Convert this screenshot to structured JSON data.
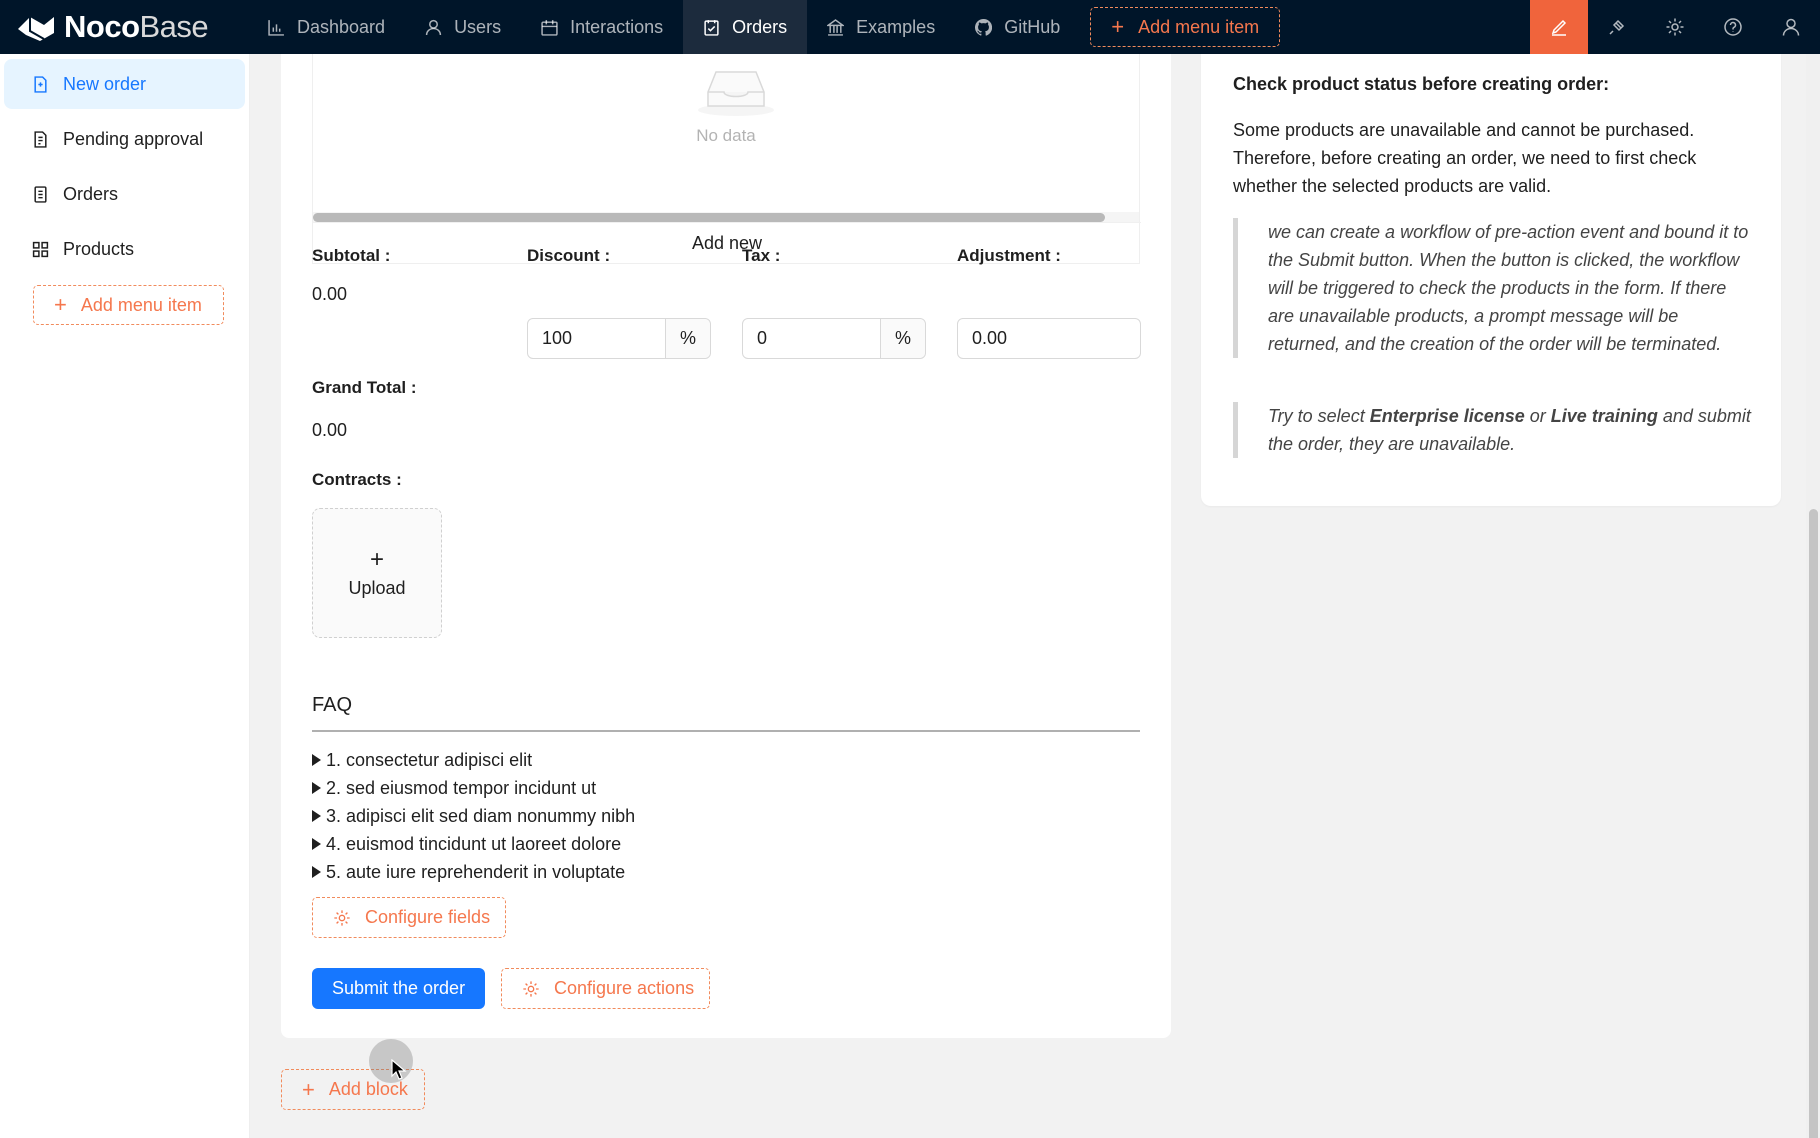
{
  "brand": {
    "name_bold": "Noco",
    "name_thin": "Base"
  },
  "topnav": {
    "items": [
      {
        "label": "Dashboard",
        "icon": "bar-chart-icon"
      },
      {
        "label": "Users",
        "icon": "user-icon"
      },
      {
        "label": "Interactions",
        "icon": "calendar-icon"
      },
      {
        "label": "Orders",
        "icon": "schedule-icon",
        "active": true
      },
      {
        "label": "Examples",
        "icon": "bank-icon"
      },
      {
        "label": "GitHub",
        "icon": "github-icon"
      }
    ],
    "add_menu_item": "Add menu item"
  },
  "sidebar": {
    "items": [
      {
        "label": "New order",
        "active": true
      },
      {
        "label": "Pending approval"
      },
      {
        "label": "Orders"
      },
      {
        "label": "Products"
      }
    ],
    "add_menu_item": "Add menu item"
  },
  "table": {
    "empty_text": "No data",
    "add_new": "Add new"
  },
  "form": {
    "subtotal": {
      "label": "Subtotal",
      "value": "0.00"
    },
    "discount": {
      "label": "Discount",
      "value": "100",
      "unit": "%"
    },
    "tax": {
      "label": "Tax",
      "value": "0",
      "unit": "%"
    },
    "adjustment": {
      "label": "Adjustment",
      "value": "0.00"
    },
    "grand_total": {
      "label": "Grand Total",
      "value": "0.00"
    },
    "contracts": {
      "label": "Contracts",
      "upload": "Upload"
    }
  },
  "faq": {
    "title": "FAQ",
    "items": [
      "1. consectetur adipisci elit",
      "2. sed eiusmod tempor incidunt ut",
      "3. adipisci elit sed diam nonummy nibh",
      "4. euismod tincidunt ut laoreet dolore",
      "5. aute iure reprehenderit in voluptate"
    ]
  },
  "actions": {
    "configure_fields": "Configure fields",
    "submit": "Submit the order",
    "configure_actions": "Configure actions",
    "add_block": "Add block"
  },
  "info": {
    "title": "Check product status before creating order:",
    "paragraph": "Some products are unavailable and cannot be purchased. Therefore, before creating an order, we need to first check whether the selected products are valid.",
    "quote1": "we can create a workflow of pre-action event and bound it to the Submit button. When the button is clicked, the workflow will be triggered to check the products in the form. If there are unavailable products, a prompt message will be returned, and the creation of the order will be terminated.",
    "quote2_pre": "Try to select ",
    "quote2_b1": "Enterprise license",
    "quote2_mid": " or ",
    "quote2_b2": "Live training",
    "quote2_post": " and submit the order, they are unavailable."
  },
  "colors": {
    "topbar": "#001529",
    "accent": "#f5774d",
    "primary": "#1677ff",
    "active_bg": "#e6f4ff"
  }
}
